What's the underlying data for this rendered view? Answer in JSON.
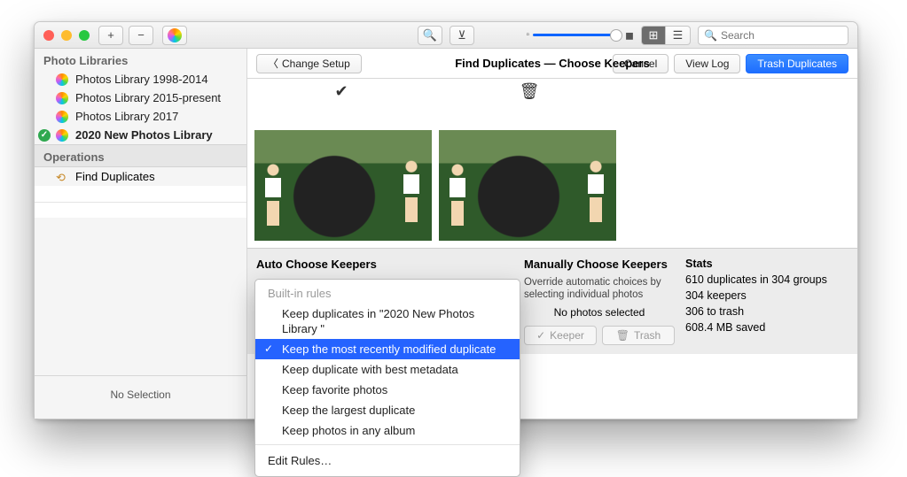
{
  "toolbar": {
    "search_placeholder": "Search"
  },
  "sidebar": {
    "libraries_header": "Photo Libraries",
    "libraries": [
      "Photos Library 1998-2014",
      "Photos Library 2015-present",
      "Photos Library 2017",
      "2020 New Photos Library"
    ],
    "operations_header": "Operations",
    "operations": [
      "Find Duplicates"
    ],
    "no_selection": "No Selection"
  },
  "header": {
    "change_setup": "Change Setup",
    "title": "Find Duplicates — Choose Keepers",
    "cancel": "Cancel",
    "view_log": "View Log",
    "trash": "Trash Duplicates"
  },
  "auto": {
    "title": "Auto Choose Keepers",
    "built_in": "Built-in rules",
    "rules": [
      "Keep duplicates in \"2020 New Photos Library \"",
      "Keep the most recently modified duplicate",
      "Keep duplicate with best metadata",
      "Keep favorite photos",
      "Keep the largest duplicate",
      "Keep photos in any album"
    ],
    "edit": "Edit Rules…"
  },
  "manual": {
    "title": "Manually Choose Keepers",
    "hint": "Override automatic choices by selecting individual photos",
    "none": "No photos selected",
    "keeper": "Keeper",
    "trash": "Trash"
  },
  "stats": {
    "title": "Stats",
    "line1": "610 duplicates in 304 groups",
    "line2": "304 keepers",
    "line3": "306 to trash",
    "line4": "608.4 MB saved"
  }
}
